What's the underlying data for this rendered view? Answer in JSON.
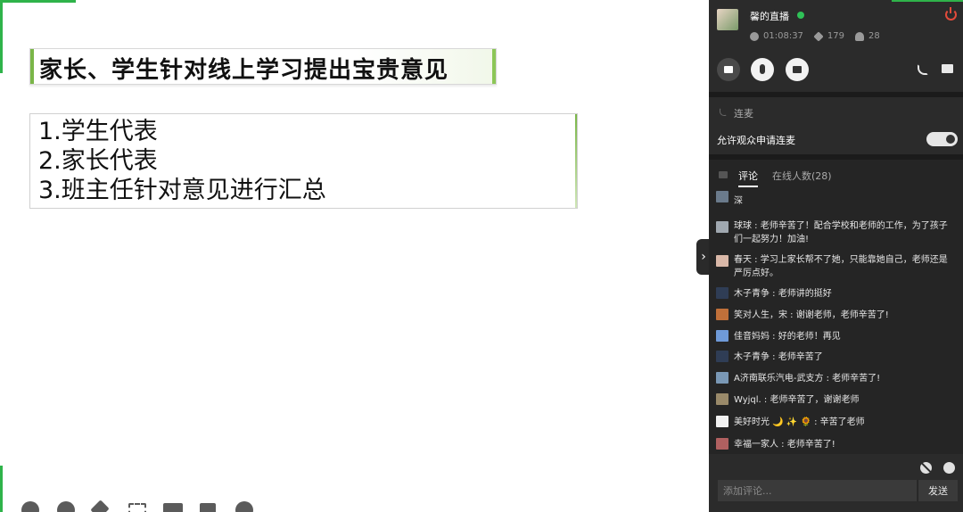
{
  "slide": {
    "title": "家长、学生针对线上学习提出宝贵意见",
    "items": [
      "1.学生代表",
      "2.家长代表",
      "3.班主任针对意见进行汇总"
    ]
  },
  "live": {
    "room_title": "馨的直播",
    "duration": "01:08:37",
    "likes": "179",
    "viewers": "28",
    "status_color": "#2fc157"
  },
  "lianmai": {
    "title": "连麦",
    "allow_label": "允许观众申请连麦",
    "allow_enabled": true
  },
  "tabs": {
    "comment": "评论",
    "online": "在线人数(28)"
  },
  "comments": [
    {
      "text": "深",
      "avatar_color": "#6b7b8c"
    },
    {
      "text": "球球 : 老师辛苦了！配合学校和老师的工作，为了孩子们一起努力！加油!",
      "avatar_color": "#a0a8b0"
    },
    {
      "text": "春天 : 学习上家长帮不了她，只能靠她自己，老师还是严厉点好。",
      "avatar_color": "#d9b8a8"
    },
    {
      "text": "木子青争 : 老师讲的挺好",
      "avatar_color": "#2f3d55"
    },
    {
      "text": "笑对人生，宋 : 谢谢老师，老师辛苦了!",
      "avatar_color": "#c0703a"
    },
    {
      "text": "佳音妈妈 : 好的老师！再见",
      "avatar_color": "#6f9ad8"
    },
    {
      "text": "木子青争 : 老师辛苦了",
      "avatar_color": "#2f3d55"
    },
    {
      "text": "A济南联乐汽电-武支方 : 老师辛苦了!",
      "avatar_color": "#7a98b5"
    },
    {
      "text": "Wyjql. : 老师辛苦了，谢谢老师",
      "avatar_color": "#9a8a6a"
    },
    {
      "text": "美好时光 🌙 ✨ 🌻 : 辛苦了老师",
      "avatar_color": "#f2f2f2"
    },
    {
      "text": "幸福一家人 : 老师辛苦了!",
      "avatar_color": "#b06060"
    }
  ],
  "input": {
    "placeholder": "添加评论...",
    "send_label": "发送"
  },
  "toggle_panel_glyph": "›"
}
